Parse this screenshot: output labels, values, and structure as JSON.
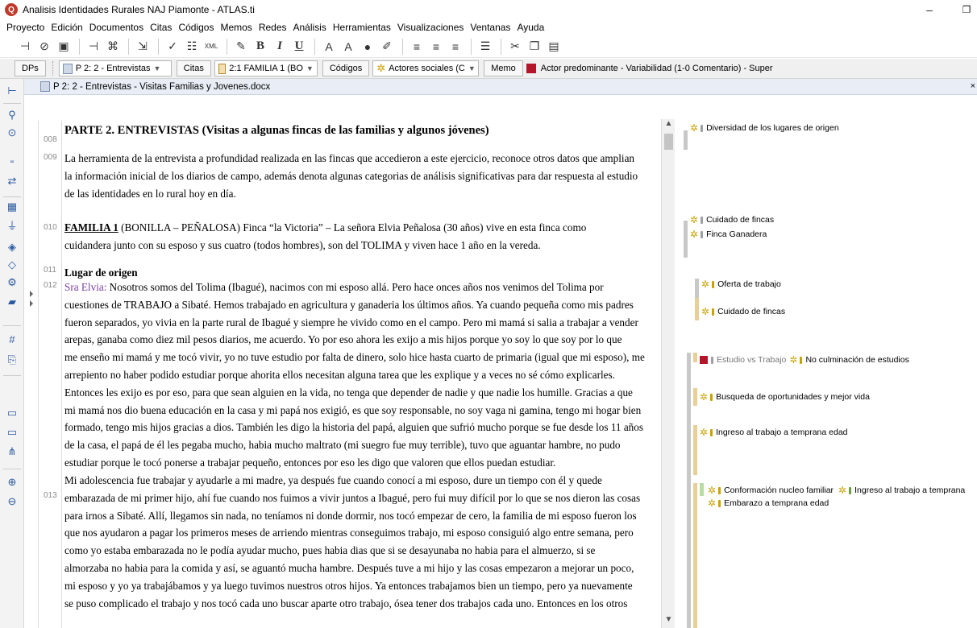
{
  "window": {
    "title": "Analisis Identidades Rurales NAJ Piamonte - ATLAS.ti",
    "app_icon": "atlas-icon",
    "minimize": "–",
    "maximize": "❐"
  },
  "menu": [
    "Proyecto",
    "Edición",
    "Documentos",
    "Citas",
    "Códigos",
    "Memos",
    "Redes",
    "Análisis",
    "Herramientas",
    "Visualizaciones",
    "Ventanas",
    "Ayuda"
  ],
  "toolbar": {
    "bold": "B",
    "italic": "I",
    "underline": "U",
    "wiki": "XML"
  },
  "navbar": {
    "dps": "DPs",
    "doc_combo": "P 2: 2 - Entrevistas",
    "citas": "Citas",
    "quote_combo": "2:1 FAMILIA 1 (BO",
    "codigos": "Códigos",
    "code_combo": "Actores sociales (C",
    "memo": "Memo",
    "memo_text": "Actor predominante - Variabilidad (1-0 Comentario) - Super"
  },
  "doc_header": {
    "title": "P 2: 2 - Entrevistas - Visitas Familias y Jovenes.docx",
    "close": "×"
  },
  "paragraph_numbers": [
    "008",
    "009",
    "010",
    "011",
    "012",
    "013"
  ],
  "document": {
    "p008": "PARTE 2. ENTREVISTAS (Visitas a algunas fincas de las familias y algunos jóvenes)",
    "p009_l1": "La herramienta de la entrevista a profundidad realizada en las fincas que accedieron a este ejercicio, reconoce otros datos que amplian",
    "p009_l2": "la información inicial de los diarios de campo, además denota algunas categorias de análisis significativas para dar respuesta al estudio",
    "p009_l3": "de las identidades en lo rural hoy en día.",
    "p010_fam": "FAMILIA 1",
    "p010_l1": " (BONILLA – PEÑALOSA) Finca “la Victoria” – La señora Elvia Peñalosa (30 años) vive en esta finca como",
    "p010_l2": "cuidandera junto con su esposo y sus cuatro (todos hombres), son del TOLIMA y viven hace 1 año en la vereda.",
    "p011": "Lugar de origen",
    "p012_speaker": "Sra Elvia:",
    "p012_l1": " Nosotros somos del Tolima (Ibagué), nacimos con mi esposo allá. Pero hace onces años nos venimos del Tolima por",
    "p012_l2": "cuestiones de TRABAJO a Sibaté. Hemos trabajado en agricultura y ganaderia los últimos años. Ya cuando pequeña como mis padres",
    "p012_l3": "fueron separados, yo vivia en la parte rural de Ibagué y siempre he vivido como en el campo. Pero mi mamá si salia a trabajar a vender",
    "p012_l4": "arepas, ganaba como diez mil pesos diarios, me acuerdo. Yo por eso ahora les exijo a mis hijos porque yo soy lo que soy por lo que",
    "p012_l5": "me enseño mi mamá y me tocó vivir, yo no tuve estudio por falta de dinero, solo hice hasta cuarto de primaria (igual que mi esposo), me",
    "p012_l6": "arrepiento no haber podido estudiar porque ahorita ellos necesitan alguna tarea que les explique y a veces no sé cómo explicarles.",
    "p012_l7": "Entonces les exijo es por eso, para que sean alguien en la vida, no tenga que depender de nadie y que nadie los humille. Gracias a que",
    "p012_l8": "mi mamá nos dio buena educación en la casa y mi papá nos exigió, es que soy responsable, no soy vaga ni gamina, tengo mi hogar bien",
    "p012_l9": "formado, tengo mis hijos gracias a dios. También les digo la historia del papá, alguien que sufrió mucho porque se fue desde los 11 años",
    "p012_l10": "de la casa, el papá de él les pegaba mucho, habia mucho maltrato (mi suegro fue muy terrible), tuvo que aguantar hambre, no pudo",
    "p012_l11": "estudiar porque le tocó ponerse a trabajar pequeño, entonces por eso les digo que valoren que ellos puedan estudiar.",
    "p013_l1": "Mi adolescencia fue trabajar y ayudarle a mi madre, ya después fue cuando conocí a mi esposo, dure un tiempo con él y quede",
    "p013_l2": "embarazada de mi primer hijo, ahí fue cuando nos fuimos a vivir juntos a Ibagué, pero fui muy difícil por lo que se nos dieron las cosas",
    "p013_l3": "para irnos a Sibaté. Allí, llegamos sin nada, no teníamos ni donde dormir, nos tocó empezar de cero, la familia de mi esposo fueron los",
    "p013_l4": "que nos ayudaron a pagar los primeros meses de arriendo mientras conseguimos trabajo, mi esposo consiguió algo entre semana, pero",
    "p013_l5": "como yo estaba embarazada no le podía ayudar mucho, pues habia dias que si se desayunaba no habia para el almuerzo, si se",
    "p013_l6": "almorzaba no habia para la comida y así, se aguantó mucha hambre. Después tuve a mi hijo y las cosas empezaron a mejorar un poco,",
    "p013_l7": "mi esposo y yo ya trabajábamos y ya luego tuvimos nuestros otros hijos. Ya entonces trabajamos bien un tiempo, pero ya nuevamente",
    "p013_l8": "se puso complicado el trabajo y nos tocó cada uno buscar aparte otro trabajo, ósea tener dos trabajos cada uno. Entonces en los otros"
  },
  "codes": {
    "c1": "Diversidad de los lugares de origen",
    "c2": "Cuidado de fincas",
    "c3": "Finca Ganadera",
    "c4": "Oferta de trabajo",
    "c5": "Cuidado de fincas",
    "c6_memo": "Estudio vs Trabajo",
    "c6": "No culminación de estudios",
    "c7": "Busqueda de oportunidades y mejor vida",
    "c8": "Ingreso al trabajo a temprana edad",
    "c9a": "Conformación nucleo familiar",
    "c9b": "Ingreso al trabajo a temprana",
    "c10": "Embarazo a temprana edad"
  },
  "colors": {
    "code_icon": "#c9a100",
    "memo_icon": "#b3162b",
    "bracket_gray": "#c8c8c8",
    "bracket_tan": "#e8cf98",
    "bracket_green": "#b9dba4",
    "speaker": "#7a3fa0"
  }
}
